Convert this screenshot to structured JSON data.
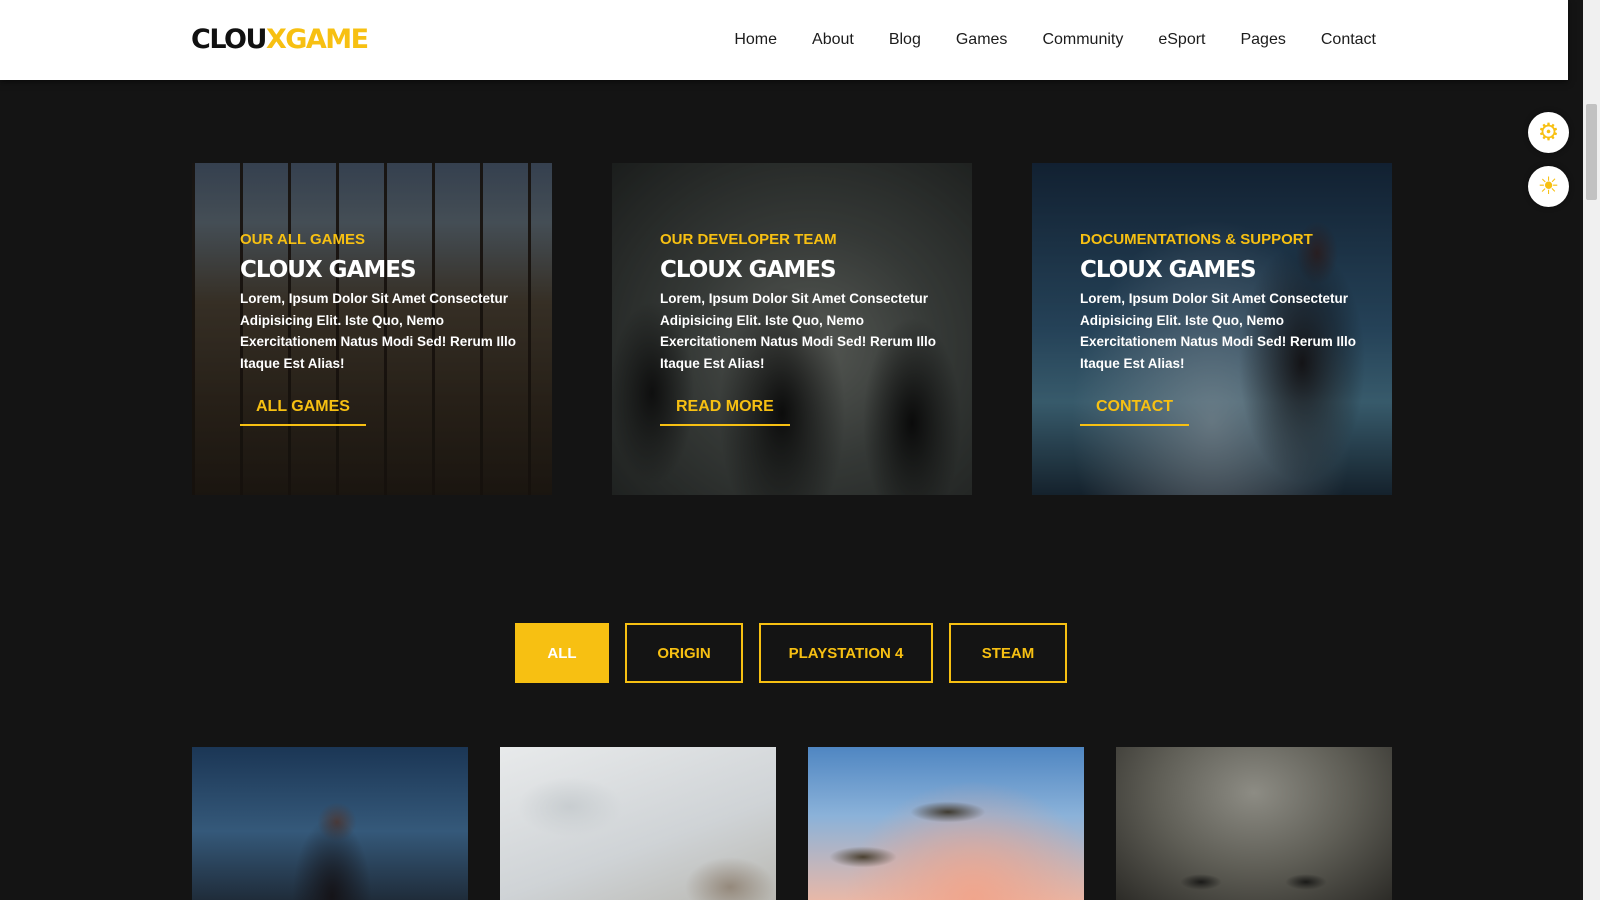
{
  "brand": {
    "part1": "CLOU",
    "part2": "XGAME"
  },
  "nav": [
    "Home",
    "About",
    "Blog",
    "Games",
    "Community",
    "eSport",
    "Pages",
    "Contact"
  ],
  "floating_buttons": [
    {
      "icon": "gear-icon",
      "glyph": "⚙"
    },
    {
      "icon": "sun-icon",
      "glyph": "☀"
    }
  ],
  "cards": [
    {
      "eyebrow": "OUR ALL GAMES",
      "title": "CLOUX GAMES",
      "text": "Lorem, Ipsum Dolor Sit Amet Consectetur Adipisicing Elit. Iste Quo, Nemo Exercitationem Natus Modi Sed! Rerum Illo Itaque Est Alias!",
      "cta": "ALL GAMES"
    },
    {
      "eyebrow": "OUR DEVELOPER TEAM",
      "title": "CLOUX GAMES",
      "text": "Lorem, Ipsum Dolor Sit Amet Consectetur Adipisicing Elit. Iste Quo, Nemo Exercitationem Natus Modi Sed! Rerum Illo Itaque Est Alias!",
      "cta": "READ MORE"
    },
    {
      "eyebrow": "DOCUMENTATIONS & SUPPORT",
      "title": "CLOUX GAMES",
      "text": "Lorem, Ipsum Dolor Sit Amet Consectetur Adipisicing Elit. Iste Quo, Nemo Exercitationem Natus Modi Sed! Rerum Illo Itaque Est Alias!",
      "cta": "CONTACT"
    }
  ],
  "filters": [
    {
      "label": "ALL",
      "active": true
    },
    {
      "label": "ORIGIN",
      "active": false
    },
    {
      "label": "PLAYSTATION 4",
      "active": false
    },
    {
      "label": "STEAM",
      "active": false
    }
  ],
  "colors": {
    "accent": "#f7c012",
    "background": "#141414",
    "navbar": "#ffffff",
    "nav_text": "#1c1c1c"
  }
}
